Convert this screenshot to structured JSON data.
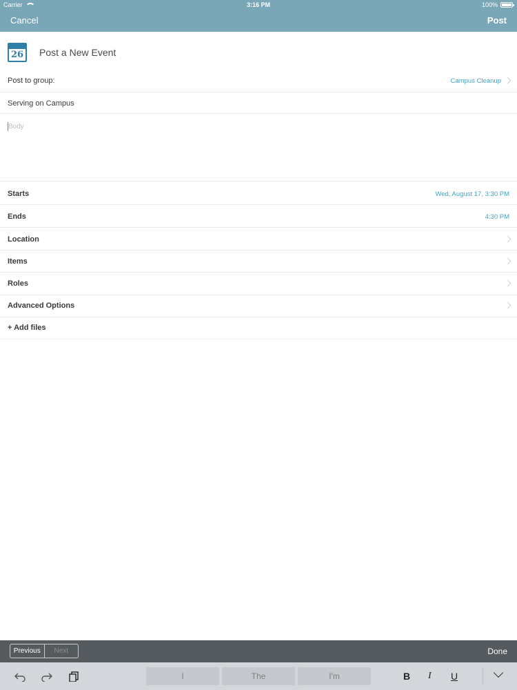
{
  "status_bar": {
    "carrier": "Carrier",
    "time": "3:16 PM",
    "battery": "100%"
  },
  "nav": {
    "cancel_label": "Cancel",
    "post_label": "Post"
  },
  "header": {
    "calendar_day": "26",
    "title": "Post a New Event"
  },
  "form": {
    "post_to_group": {
      "label": "Post to group:",
      "value": "Campus Cleanup"
    },
    "title_value": "Serving on Campus",
    "body_placeholder": "Body",
    "starts": {
      "label": "Starts",
      "value": "Wed, August 17, 3:30 PM"
    },
    "ends": {
      "label": "Ends",
      "value": "4:30 PM"
    },
    "location_label": "Location",
    "items_label": "Items",
    "roles_label": "Roles",
    "advanced_label": "Advanced Options",
    "add_files_label": "+ Add files"
  },
  "keyboard_toolbar": {
    "previous_label": "Previous",
    "next_label": "Next",
    "done_label": "Done"
  },
  "keyboard": {
    "predictions": [
      "I",
      "The",
      "I'm"
    ],
    "bold_label": "B",
    "italic_label": "I",
    "underline_label": "U"
  },
  "colors": {
    "nav_bg": "#7aa7b8",
    "accent": "#3fa4c4",
    "calendar": "#2f7fa8"
  }
}
